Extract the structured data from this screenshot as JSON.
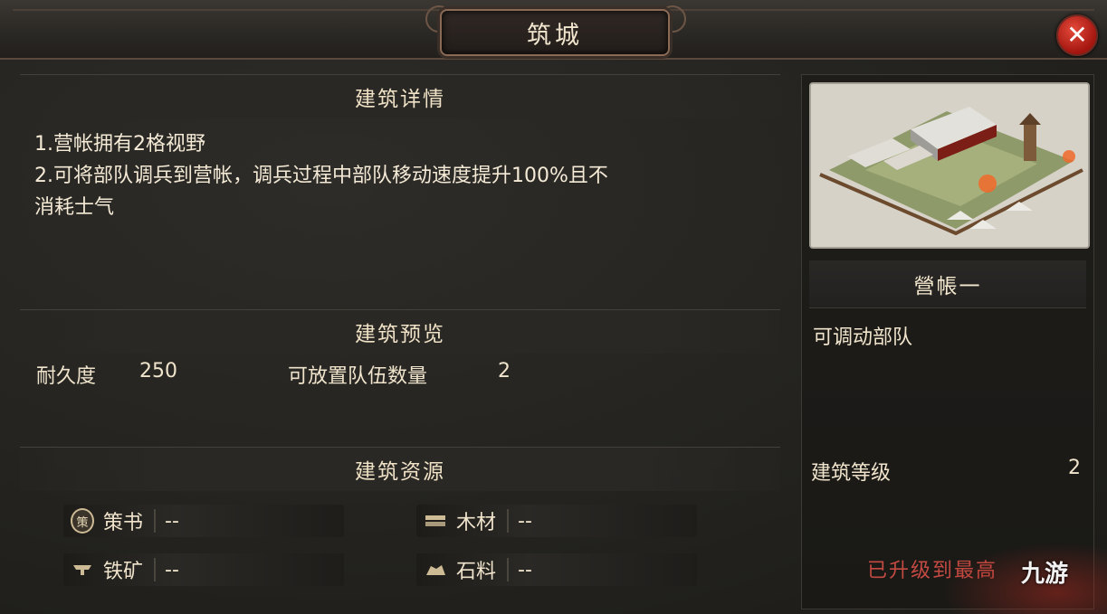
{
  "window": {
    "title": "筑城",
    "close_glyph": "✕"
  },
  "details": {
    "heading": "建筑详情",
    "lines": [
      "1.营帐拥有2格视野",
      "2.可将部队调兵到营帐，调兵过程中部队移动速度提升100%且不",
      "消耗士气"
    ]
  },
  "preview": {
    "heading": "建筑预览",
    "durability_label": "耐久度",
    "durability_value": "250",
    "troops_label": "可放置队伍数量",
    "troops_value": "2"
  },
  "resources": {
    "heading": "建筑资源",
    "items": [
      {
        "label": "策书",
        "value": "--",
        "icon": "scroll-icon",
        "icon_glyph": "策"
      },
      {
        "label": "木材",
        "value": "--",
        "icon": "wood-icon"
      },
      {
        "label": "铁矿",
        "value": "--",
        "icon": "iron-icon"
      },
      {
        "label": "石料",
        "value": "--",
        "icon": "stone-icon"
      }
    ]
  },
  "building": {
    "name": "營帳一",
    "desc": "可调动部队",
    "level_label": "建筑等级",
    "level_value": "2",
    "status": "已升级到最高"
  },
  "watermark": "九游",
  "colors": {
    "accent_red": "#c44a42",
    "close_red": "#d0271c"
  }
}
